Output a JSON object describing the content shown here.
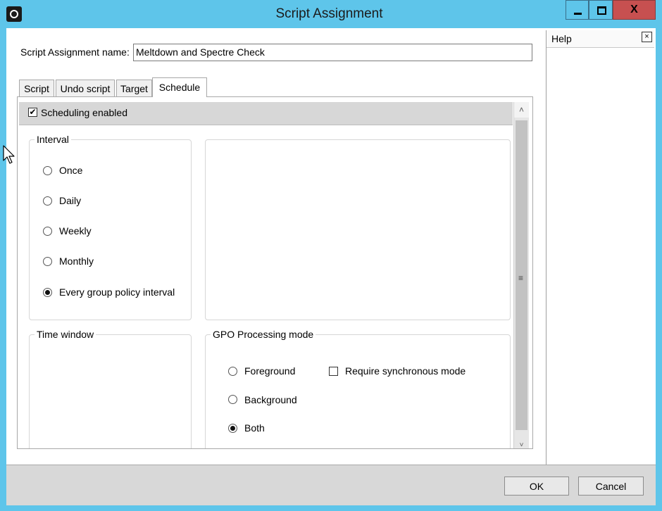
{
  "window": {
    "title": "Script Assignment",
    "close_glyph": "X",
    "accent_color": "#5ec5ea",
    "close_color": "#c75050"
  },
  "help": {
    "title": "Help",
    "close_glyph": "×"
  },
  "form": {
    "name_label": "Script Assignment name:",
    "name_value": "Meltdown and Spectre Check"
  },
  "tabs": [
    "Script",
    "Undo script",
    "Target",
    "Schedule"
  ],
  "active_tab": "Schedule",
  "schedule": {
    "enabled_label": "Scheduling enabled",
    "enabled": true,
    "check_glyph": "✔",
    "interval": {
      "title": "Interval",
      "options": [
        "Once",
        "Daily",
        "Weekly",
        "Monthly",
        "Every group policy interval"
      ],
      "selected": "Every group policy interval"
    },
    "time_window": {
      "title": "Time window"
    },
    "gpo": {
      "title": "GPO Processing mode",
      "options": [
        "Foreground",
        "Background",
        "Both"
      ],
      "selected": "Both",
      "sync_label": "Require synchronous mode",
      "sync_checked": false
    }
  },
  "scrollbar": {
    "up_glyph": "˄",
    "grip_glyph": "≡",
    "down_glyph": "˅"
  },
  "footer": {
    "ok_label": "OK",
    "cancel_label": "Cancel"
  }
}
